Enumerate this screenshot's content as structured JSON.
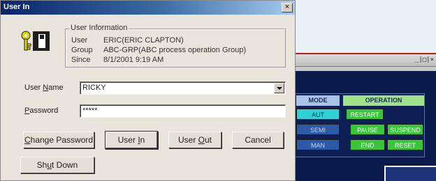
{
  "dialog": {
    "title": "User In",
    "close_glyph": "×",
    "group_title": "User Information",
    "user_label": "User",
    "user_value": "ERIC(ERIC CLAPTON)",
    "group_label": "Group",
    "group_value": "ABC-GRP(ABC process operation Group)",
    "since_label": "Since",
    "since_value": "8/1/2001 9:19 AM",
    "username_label_pre": "User ",
    "username_label_u": "N",
    "username_label_post": "ame",
    "username_value": "RICKY",
    "password_label_u": "P",
    "password_label_post": "assword",
    "password_value": "*****",
    "buttons": {
      "change_password_u": "C",
      "change_password_post": "hange Password",
      "user_in_pre": "User ",
      "user_in_u": "I",
      "user_in_post": "n",
      "user_out_pre": "User ",
      "user_out_u": "O",
      "user_out_post": "ut",
      "cancel": "Cancel",
      "shut_down_pre": "Sh",
      "shut_down_u": "u",
      "shut_down_post": "t Down"
    },
    "icon": "user-key-icon"
  },
  "background_window": {
    "window_buttons": "_|□|×",
    "mode_header": "MODE",
    "operation_header": "OPERATION",
    "mode_buttons": [
      "AUT",
      "SEMI",
      "MAN"
    ],
    "operation_buttons": [
      "RESTART",
      "PAUSE",
      "SUSPEND",
      "END",
      "RESET"
    ]
  },
  "colors": {
    "title_gradient_start": "#0a246a",
    "dialog_face": "#e9e4dc",
    "panel_bg": "#0d1f55",
    "op_green": "#39c63a",
    "mode_cyan": "#2fd1d6",
    "mode_blue": "#2c5aa6"
  }
}
